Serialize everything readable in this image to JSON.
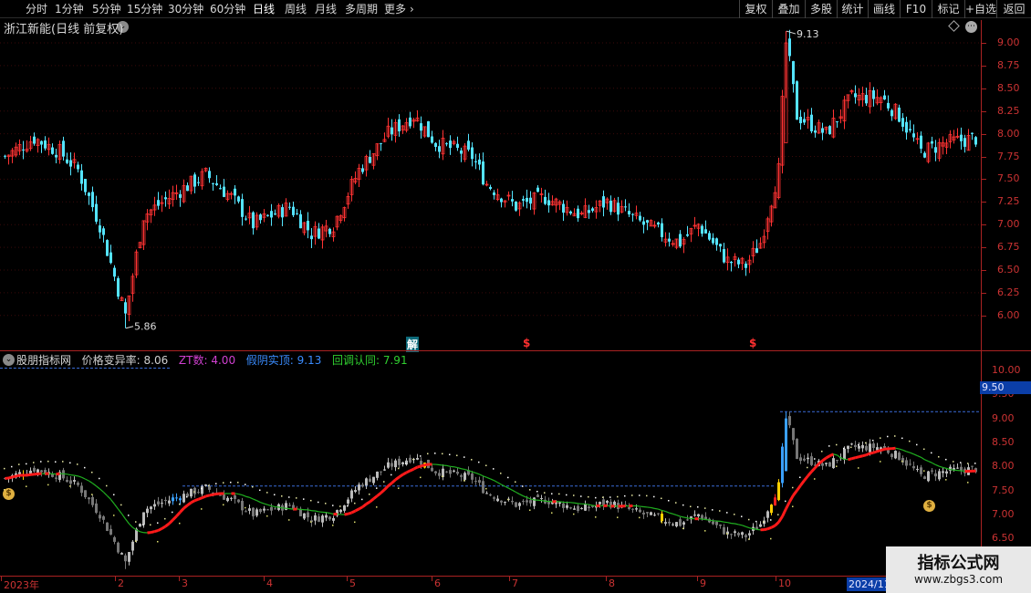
{
  "toolbar": {
    "timeframes": [
      "分时",
      "1分钟",
      "5分钟",
      "15分钟",
      "30分钟",
      "60分钟",
      "日线",
      "周线",
      "月线",
      "多周期",
      "更多"
    ],
    "active_timeframe": "日线",
    "buttons": [
      "复权",
      "叠加",
      "多股",
      "统计",
      "画线",
      "F10",
      "标记",
      "+自选",
      "返回"
    ]
  },
  "main_chart": {
    "title": "浙江新能(日线 前复权)",
    "high_label": "9.13",
    "low_label": "5.86",
    "y_ticks": [
      "9.00",
      "8.75",
      "8.50",
      "8.25",
      "8.00",
      "7.75",
      "7.50",
      "7.25",
      "7.00",
      "6.75",
      "6.50",
      "6.25",
      "6.00"
    ],
    "event_markers": [
      "解",
      "$",
      "$"
    ]
  },
  "indicator": {
    "name": "股朋指标网",
    "items": [
      {
        "label": "价格变异率:",
        "value": "8.06",
        "color": "#d0d0d0"
      },
      {
        "label": "ZT数:",
        "value": "4.00",
        "color": "#d040d0"
      },
      {
        "label": "假阴实顶:",
        "value": "9.13",
        "color": "#3a8cff"
      },
      {
        "label": "回调认同:",
        "value": "7.91",
        "color": "#30d030"
      }
    ],
    "y_ticks": [
      "10.00",
      "9.50",
      "9.00",
      "8.50",
      "8.00",
      "7.50",
      "7.00",
      "6.50"
    ],
    "price_tag": "9.50",
    "bag_icon": "money-bag-icon"
  },
  "date_axis": {
    "labels": [
      "2023年",
      "2",
      "3",
      "4",
      "5",
      "6",
      "7",
      "8",
      "9",
      "10"
    ],
    "current_box": "2024/11"
  },
  "watermark": {
    "line1": "指标公式网",
    "line2": "www.zbgs3.com"
  },
  "chart_data": {
    "type": "candlestick",
    "period": "daily",
    "price_range_main": [
      5.86,
      9.13
    ],
    "approx_close_path": [
      {
        "month": "2023年",
        "close": 7.85
      },
      {
        "month": "2",
        "close": 6.0
      },
      {
        "month": "3",
        "close": 7.55
      },
      {
        "month": "4",
        "close": 7.0
      },
      {
        "month": "5",
        "close": 7.9
      },
      {
        "month": "6",
        "close": 7.8
      },
      {
        "month": "7",
        "close": 7.1
      },
      {
        "month": "8",
        "close": 6.9
      },
      {
        "month": "9",
        "close": 6.6
      },
      {
        "month": "10",
        "close": 8.0
      },
      {
        "month": "2024/11",
        "close": 7.9
      }
    ],
    "colors": {
      "up": "#ff3333",
      "down": "#4fd9ff",
      "ma_down": "#e01010",
      "ma_up": "#20b020"
    }
  }
}
